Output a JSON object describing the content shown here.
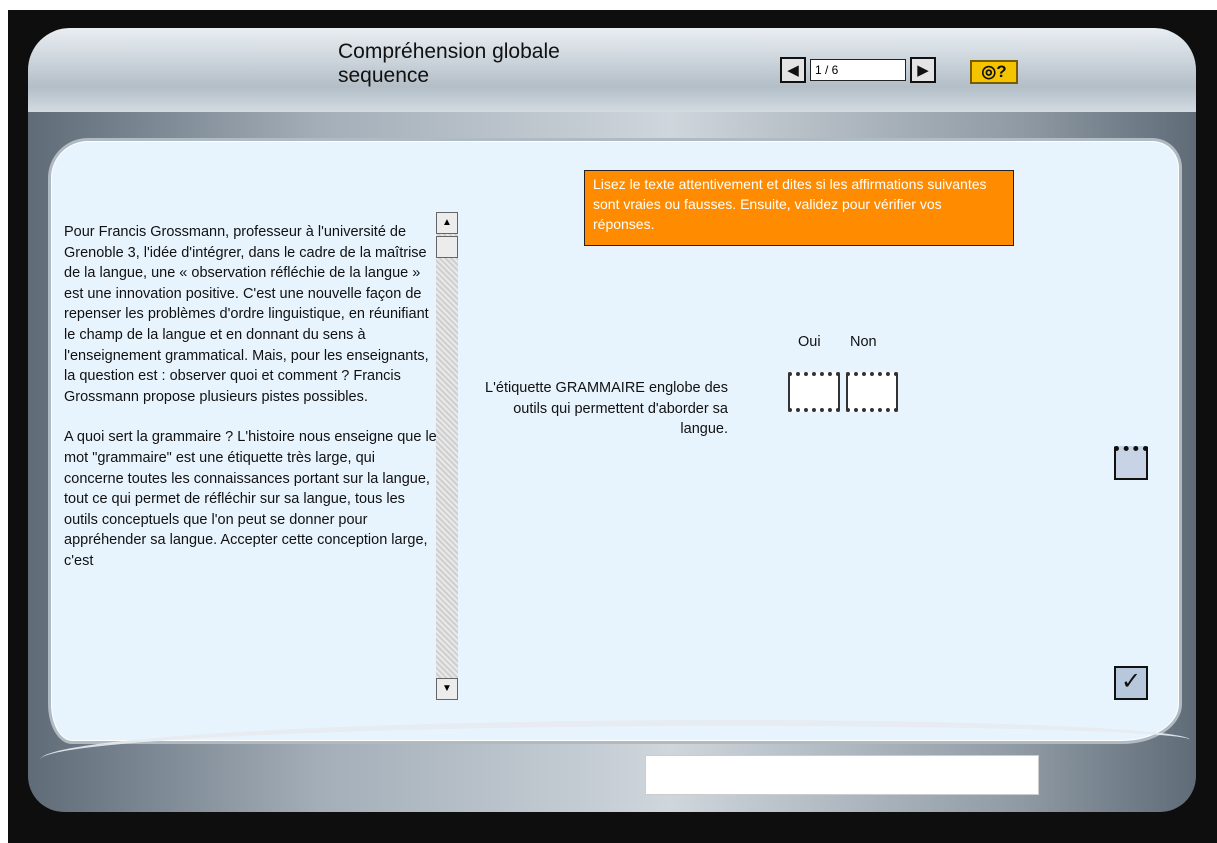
{
  "header": {
    "title_line1": "Compréhension globale",
    "title_line2": "sequence",
    "prev_icon": "◀",
    "next_icon": "▶",
    "page_indicator": "1 / 6",
    "help_label": "◎?"
  },
  "reading": {
    "paragraph1": "Pour Francis Grossmann, professeur à l'université de Grenoble 3, l'idée d'intégrer, dans le cadre de la maîtrise de la langue, une « observation réfléchie de la langue » est une innovation positive. C'est une nouvelle façon de repenser les problèmes d'ordre linguistique, en réunifiant le champ de la langue et en donnant du sens à l'enseignement grammatical. Mais, pour les enseignants,  la question est : observer quoi et comment ? Francis Grossmann propose plusieurs pistes possibles.",
    "paragraph2": "A quoi sert la grammaire ? L'histoire nous enseigne que le mot \"grammaire\" est une étiquette très large, qui concerne toutes les connaissances portant sur la langue, tout ce qui permet de réfléchir sur sa langue, tous les outils conceptuels que l'on peut se donner pour appréhender sa langue. Accepter cette conception large, c'est",
    "scroll_up": "▲",
    "scroll_down": "▼"
  },
  "instructions": "Lisez le texte attentivement et dites si les affirmations suivantes sont vraies ou fausses. Ensuite, validez pour vérifier vos réponses.",
  "quiz": {
    "col_yes": "Oui",
    "col_no": "Non",
    "question": "L'étiquette GRAMMAIRE englobe des outils qui permettent d'aborder sa langue."
  },
  "actions": {
    "validate_icon": "✓"
  }
}
